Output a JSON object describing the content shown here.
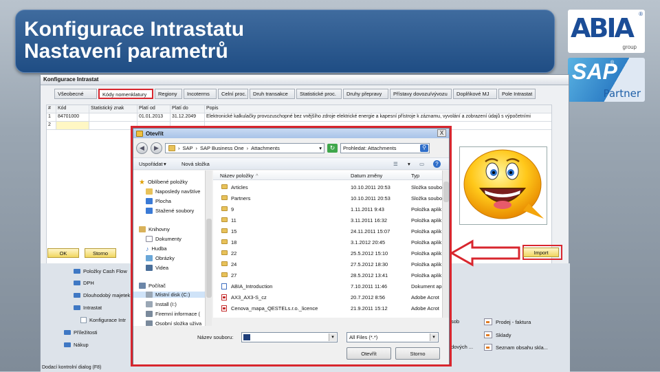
{
  "slide": {
    "title_line1": "Konfigurace Intrastatu",
    "title_line2": "Nastavení parametrů"
  },
  "logos": {
    "abia_text": "ABIA",
    "abia_reg": "®",
    "abia_sub": "group",
    "sap_text": "SAP",
    "sap_reg": "®",
    "sap_sub": "Partner"
  },
  "config_window": {
    "title": "Konfigurace Intrastat",
    "tabs": [
      "Všeobecné",
      "Kódy nomenklatury",
      "Regiony",
      "Incoterms",
      "Celní proc.",
      "Druh transakce",
      "Statistické proc.",
      "Druhy přepravy",
      "Přístavy dovozu/vývozu",
      "Doplňkové MJ",
      "Pole Intrastat"
    ],
    "active_tab": "Kódy nomenklatury",
    "grid_headers": [
      "#",
      "Kód",
      "Statistický znak",
      "Platí od",
      "Platí do",
      "Popis"
    ],
    "grid_rows": [
      [
        "1",
        "84701000",
        "",
        "01.01.2013",
        "31.12.2049",
        "Elektronické kalkulačky provozuschopné bez vnějšího zdroje elektrické energie a kapesní přístroje k záznamu, vyvolání a zobrazení údajů s výpočetními"
      ],
      [
        "2",
        "",
        "",
        "",
        "",
        ""
      ]
    ],
    "ok_label": "OK",
    "cancel_label": "Storno",
    "import_label": "Import"
  },
  "tree": {
    "items": [
      "Položky Cash Flow",
      "DPH",
      "Dlouhodobý majetek",
      "Intrastat",
      "Konfigurace Intr",
      "Příležitosti",
      "Nákup"
    ],
    "right_items": [
      "Prodej - faktura",
      "Sklady",
      "Seznam obsahu skla..."
    ],
    "partial_items": [
      "sob",
      "dových ..."
    ],
    "status_text": "Dodací kontrolní dialog (F8)"
  },
  "open_dialog": {
    "title": "Otevřít",
    "close_label": "X",
    "address_path": [
      "SAP",
      "SAP Business One",
      "Attachments"
    ],
    "search_placeholder": "Prohledat: Attachments",
    "organize_label": "Uspořádat",
    "new_folder_label": "Nová složka",
    "nav_items": [
      "Oblíbené položky",
      "Naposledy navštíve",
      "Plocha",
      "Stažené soubory",
      "Knihovny",
      "Dokumenty",
      "Hudba",
      "Obrázky",
      "Videa",
      "Počítač",
      "Místní disk (C:)",
      "Install (I:)",
      "Firemní informace (",
      "Osobní složka uživa"
    ],
    "columns": [
      "Název položky",
      "Datum změny",
      "Typ"
    ],
    "files": [
      {
        "name": "Articles",
        "date": "10.10.2011 20:53",
        "type": "Složka soubo",
        "icon": "folder-icon"
      },
      {
        "name": "Partners",
        "date": "10.10.2011 20:53",
        "type": "Složka soubo",
        "icon": "folder-icon"
      },
      {
        "name": "9",
        "date": "1.11.2011 9:43",
        "type": "Položka aplik",
        "icon": "folder-app-icon"
      },
      {
        "name": "11",
        "date": "3.11.2011 16:32",
        "type": "Položka aplik",
        "icon": "folder-app-icon"
      },
      {
        "name": "15",
        "date": "24.11.2011 15:07",
        "type": "Položka aplik",
        "icon": "folder-app-icon"
      },
      {
        "name": "18",
        "date": "3.1.2012 20:45",
        "type": "Položka aplik",
        "icon": "folder-app-icon"
      },
      {
        "name": "22",
        "date": "25.5.2012 15:10",
        "type": "Položka aplik",
        "icon": "folder-app-icon"
      },
      {
        "name": "24",
        "date": "27.5.2012 18:30",
        "type": "Položka aplik",
        "icon": "folder-app-icon"
      },
      {
        "name": "27",
        "date": "28.5.2012 13:41",
        "type": "Položka aplik",
        "icon": "folder-app-icon"
      },
      {
        "name": "ABIA_Introduction",
        "date": "7.10.2011 11:46",
        "type": "Dokument ap",
        "icon": "document-icon"
      },
      {
        "name": "AX3_AX3-S_cz",
        "date": "20.7.2012 8:56",
        "type": "Adobe Acrot",
        "icon": "pdf-icon"
      },
      {
        "name": "Cenova_mapa_QESTELs.r.o._licence",
        "date": "21.9.2011 15:12",
        "type": "Adobe Acrot",
        "icon": "pdf-icon"
      }
    ],
    "filename_label": "Název souboru:",
    "filename_value": "",
    "filetype_value": "All Files (*.*)",
    "open_label": "Otevřít",
    "cancel_label": "Storno"
  },
  "colors": {
    "title_bar": "#1f4d84",
    "highlight": "#d8262e",
    "button_yellow": "#f0d65f"
  }
}
